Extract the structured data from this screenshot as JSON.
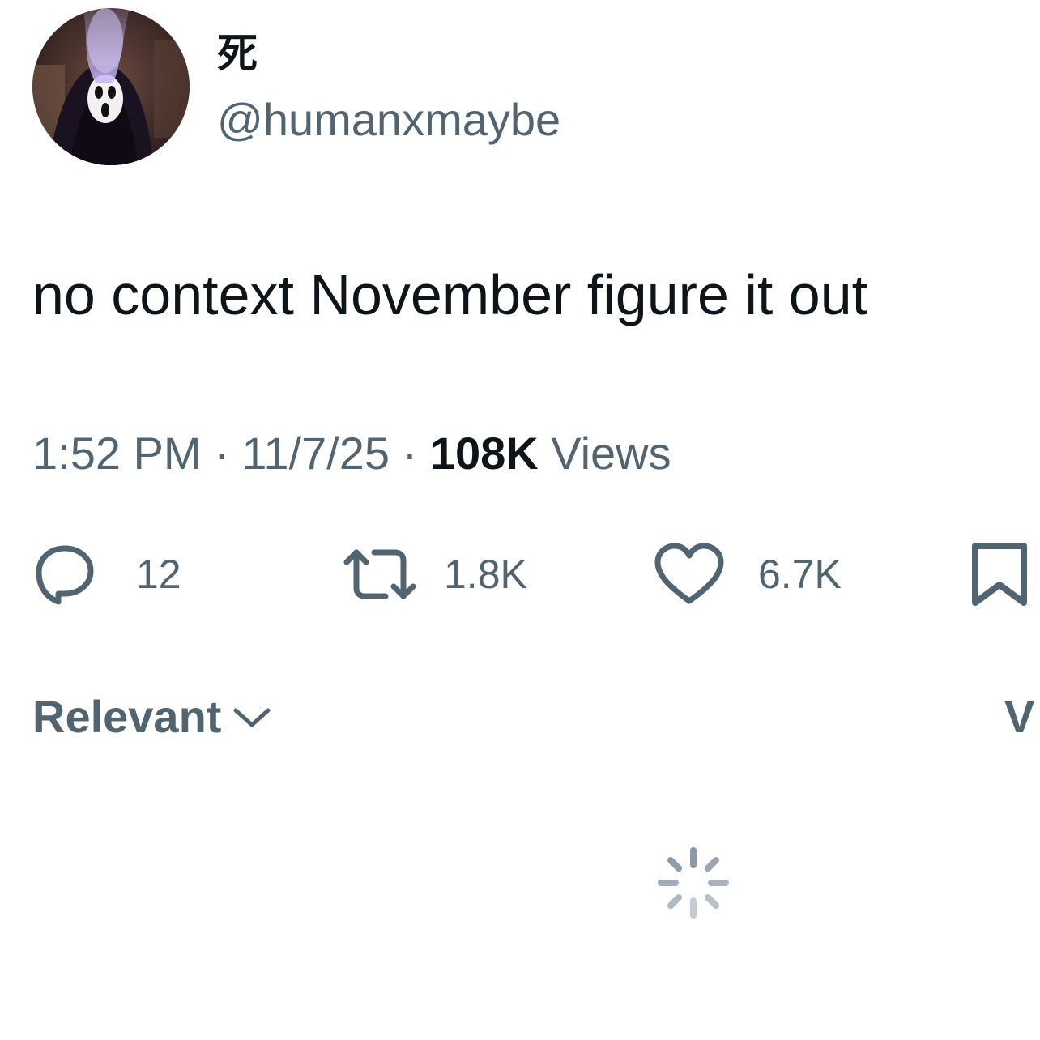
{
  "tweet": {
    "display_name": "死",
    "handle": "@humanxmaybe",
    "text": "no context November figure it out",
    "time": "1:52 PM",
    "separator": "·",
    "date": "11/7/25",
    "views_count": "108K",
    "views_label": "Views"
  },
  "actions": {
    "replies": "12",
    "retweets": "1.8K",
    "likes": "6.7K"
  },
  "replies_sort": {
    "label": "Relevant",
    "cut_tab_label": "V"
  },
  "colors": {
    "primary_text": "#0f1419",
    "secondary_text": "#536471",
    "background": "#ffffff"
  },
  "icons": [
    "avatar-image",
    "reply-icon",
    "retweet-icon",
    "like-icon",
    "bookmark-icon",
    "chevron-down-icon",
    "loading-spinner-icon"
  ]
}
